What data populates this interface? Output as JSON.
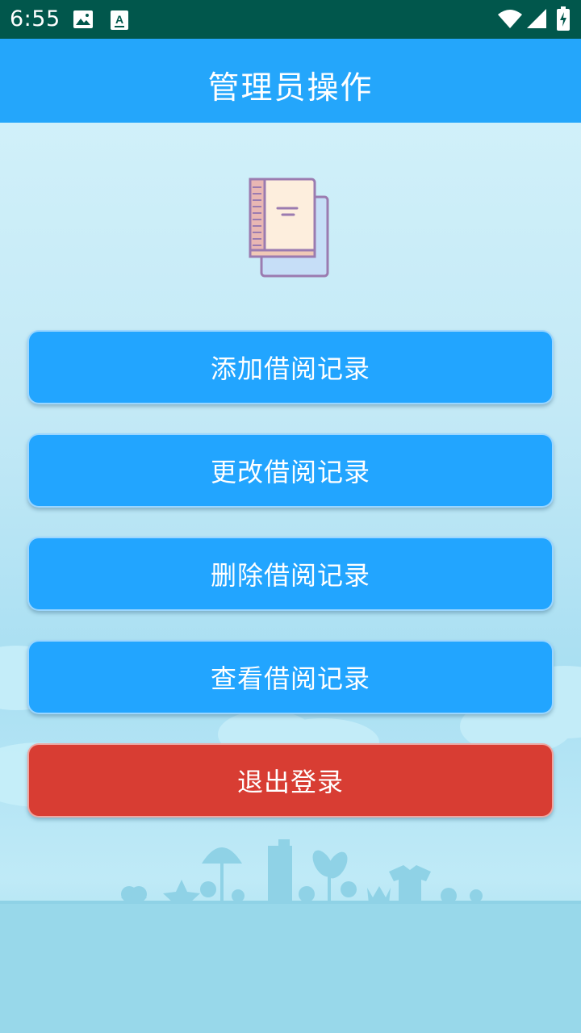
{
  "status_bar": {
    "time": "6:55",
    "icons": [
      "image-icon",
      "keyboard-a-icon",
      "wifi-icon",
      "signal-icon",
      "battery-icon"
    ]
  },
  "app_bar": {
    "title": "管理员操作"
  },
  "logo": {
    "icon": "book-icon"
  },
  "buttons": {
    "add": "添加借阅记录",
    "edit": "更改借阅记录",
    "delete": "删除借阅记录",
    "view": "查看借阅记录",
    "logout": "退出登录"
  },
  "colors": {
    "status_bar": "#01574c",
    "app_bar": "#24a6fb",
    "button": "#22a5ff",
    "logout_button": "#d83d33"
  }
}
